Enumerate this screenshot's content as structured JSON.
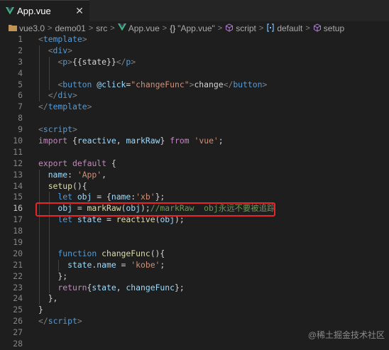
{
  "tab": {
    "title": "App.vue",
    "close_symbol": "✕"
  },
  "breadcrumb": {
    "items": [
      {
        "label": "vue3.0",
        "icon": "folder-icon"
      },
      {
        "label": "demo01"
      },
      {
        "label": "src"
      },
      {
        "label": "App.vue",
        "icon": "vue-icon"
      },
      {
        "label": "\"App.vue\"",
        "icon": "braces-icon",
        "icon_text": "{}"
      },
      {
        "label": "script",
        "icon": "cube-icon"
      },
      {
        "label": "default",
        "icon": "bracket-icon"
      },
      {
        "label": "setup",
        "icon": "cube-icon"
      }
    ],
    "separator": ">"
  },
  "editor": {
    "active_line": 16,
    "lines": [
      {
        "n": "1",
        "indent": 0,
        "tokens": [
          [
            "t-punc",
            "<"
          ],
          [
            "t-tag",
            "template"
          ],
          [
            "t-punc",
            ">"
          ]
        ]
      },
      {
        "n": "2",
        "indent": 1,
        "tokens": [
          [
            "t-punc",
            "<"
          ],
          [
            "t-tag",
            "div"
          ],
          [
            "t-punc",
            ">"
          ]
        ]
      },
      {
        "n": "3",
        "indent": 2,
        "tokens": [
          [
            "t-punc",
            "<"
          ],
          [
            "t-tag",
            "p"
          ],
          [
            "t-punc",
            ">"
          ],
          [
            "t-txt",
            "{{state}}"
          ],
          [
            "t-punc",
            "</"
          ],
          [
            "t-tag",
            "p"
          ],
          [
            "t-punc",
            ">"
          ]
        ]
      },
      {
        "n": "4",
        "indent": 2,
        "tokens": []
      },
      {
        "n": "5",
        "indent": 2,
        "tokens": [
          [
            "t-punc",
            "<"
          ],
          [
            "t-tag",
            "button"
          ],
          [
            "t-txt",
            " "
          ],
          [
            "t-attr",
            "@click"
          ],
          [
            "t-txt",
            "="
          ],
          [
            "t-str",
            "\"changeFunc\""
          ],
          [
            "t-punc",
            ">"
          ],
          [
            "t-txt",
            "change"
          ],
          [
            "t-punc",
            "</"
          ],
          [
            "t-tag",
            "button"
          ],
          [
            "t-punc",
            ">"
          ]
        ]
      },
      {
        "n": "6",
        "indent": 1,
        "tokens": [
          [
            "t-punc",
            "</"
          ],
          [
            "t-tag",
            "div"
          ],
          [
            "t-punc",
            ">"
          ]
        ]
      },
      {
        "n": "7",
        "indent": 0,
        "tokens": [
          [
            "t-punc",
            "</"
          ],
          [
            "t-tag",
            "template"
          ],
          [
            "t-punc",
            ">"
          ]
        ]
      },
      {
        "n": "8",
        "indent": 0,
        "tokens": []
      },
      {
        "n": "9",
        "indent": 0,
        "tokens": [
          [
            "t-punc",
            "<"
          ],
          [
            "t-tag",
            "script"
          ],
          [
            "t-punc",
            ">"
          ]
        ]
      },
      {
        "n": "10",
        "indent": 0,
        "tokens": [
          [
            "t-ctrl",
            "import"
          ],
          [
            "t-txt",
            " {"
          ],
          [
            "t-var",
            "reactive"
          ],
          [
            "t-txt",
            ", "
          ],
          [
            "t-var",
            "markRaw"
          ],
          [
            "t-txt",
            "} "
          ],
          [
            "t-ctrl",
            "from"
          ],
          [
            "t-txt",
            " "
          ],
          [
            "t-str",
            "'vue'"
          ],
          [
            "t-txt",
            ";"
          ]
        ]
      },
      {
        "n": "11",
        "indent": 0,
        "tokens": []
      },
      {
        "n": "12",
        "indent": 0,
        "tokens": [
          [
            "t-ctrl",
            "export"
          ],
          [
            "t-txt",
            " "
          ],
          [
            "t-ctrl",
            "default"
          ],
          [
            "t-txt",
            " {"
          ]
        ]
      },
      {
        "n": "13",
        "indent": 1,
        "tokens": [
          [
            "t-var",
            "name"
          ],
          [
            "t-txt",
            ": "
          ],
          [
            "t-str",
            "'App'"
          ],
          [
            "t-txt",
            ","
          ]
        ]
      },
      {
        "n": "14",
        "indent": 1,
        "tokens": [
          [
            "t-fn",
            "setup"
          ],
          [
            "t-txt",
            "(){"
          ]
        ]
      },
      {
        "n": "15",
        "indent": 2,
        "tokens": [
          [
            "t-kw",
            "let"
          ],
          [
            "t-txt",
            " "
          ],
          [
            "t-var",
            "obj"
          ],
          [
            "t-txt",
            " = {"
          ],
          [
            "t-var",
            "name"
          ],
          [
            "t-txt",
            ":"
          ],
          [
            "t-str",
            "'xb'"
          ],
          [
            "t-txt",
            "};"
          ]
        ]
      },
      {
        "n": "16",
        "indent": 2,
        "tokens": [
          [
            "t-var",
            "obj"
          ],
          [
            "t-txt",
            " = "
          ],
          [
            "t-fn",
            "markRaw"
          ],
          [
            "t-txt",
            "("
          ],
          [
            "t-var",
            "obj"
          ],
          [
            "t-txt",
            ");"
          ],
          [
            "t-cmt",
            "//markRaw  obj永远不要被追踪"
          ]
        ]
      },
      {
        "n": "17",
        "indent": 2,
        "tokens": [
          [
            "t-kw",
            "let"
          ],
          [
            "t-txt",
            " "
          ],
          [
            "t-var",
            "state"
          ],
          [
            "t-txt",
            " = "
          ],
          [
            "t-fn",
            "reactive"
          ],
          [
            "t-txt",
            "("
          ],
          [
            "t-var",
            "obj"
          ],
          [
            "t-txt",
            ");"
          ]
        ]
      },
      {
        "n": "18",
        "indent": 2,
        "tokens": []
      },
      {
        "n": "19",
        "indent": 2,
        "tokens": []
      },
      {
        "n": "20",
        "indent": 2,
        "tokens": [
          [
            "t-kw",
            "function"
          ],
          [
            "t-txt",
            " "
          ],
          [
            "t-fn",
            "changeFunc"
          ],
          [
            "t-txt",
            "(){"
          ]
        ]
      },
      {
        "n": "21",
        "indent": 3,
        "tokens": [
          [
            "t-var",
            "state"
          ],
          [
            "t-txt",
            "."
          ],
          [
            "t-var",
            "name"
          ],
          [
            "t-txt",
            " = "
          ],
          [
            "t-str",
            "'kobe'"
          ],
          [
            "t-txt",
            ";"
          ]
        ]
      },
      {
        "n": "22",
        "indent": 2,
        "tokens": [
          [
            "t-txt",
            "};"
          ]
        ]
      },
      {
        "n": "23",
        "indent": 2,
        "tokens": [
          [
            "t-ctrl",
            "return"
          ],
          [
            "t-txt",
            "{"
          ],
          [
            "t-var",
            "state"
          ],
          [
            "t-txt",
            ", "
          ],
          [
            "t-var",
            "changeFunc"
          ],
          [
            "t-txt",
            "};"
          ]
        ]
      },
      {
        "n": "24",
        "indent": 1,
        "tokens": [
          [
            "t-txt",
            "},"
          ]
        ]
      },
      {
        "n": "25",
        "indent": 0,
        "tokens": [
          [
            "t-txt",
            "}"
          ]
        ]
      },
      {
        "n": "26",
        "indent": 0,
        "tokens": [
          [
            "t-punc",
            "</"
          ],
          [
            "t-tag",
            "script"
          ],
          [
            "t-punc",
            ">"
          ]
        ]
      },
      {
        "n": "27",
        "indent": 0,
        "tokens": []
      },
      {
        "n": "28",
        "indent": 0,
        "tokens": []
      }
    ]
  },
  "highlight_box_color": "#e8262a",
  "watermark": "@稀土掘金技术社区"
}
